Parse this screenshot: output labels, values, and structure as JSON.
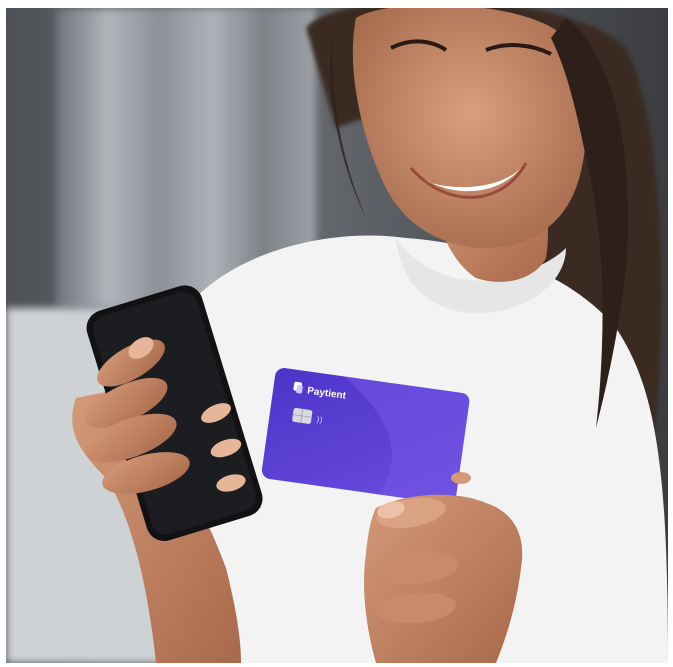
{
  "photo": {
    "subject": "woman-holding-phone-and-card",
    "colors": {
      "background_wall": "#5b5e63",
      "curtain": "#9a9ea3",
      "sofa": "#cfd2d5",
      "shirt": "#f3f3f3",
      "skin": "#c98a67",
      "hair": "#3a2a22",
      "phone": "#121214",
      "card": "#5b3fd6"
    }
  },
  "card": {
    "brand": "Paytient",
    "logo_icon": "paytient-logo-icon",
    "chip_icon": "card-chip-icon",
    "contactless_text": "))"
  }
}
